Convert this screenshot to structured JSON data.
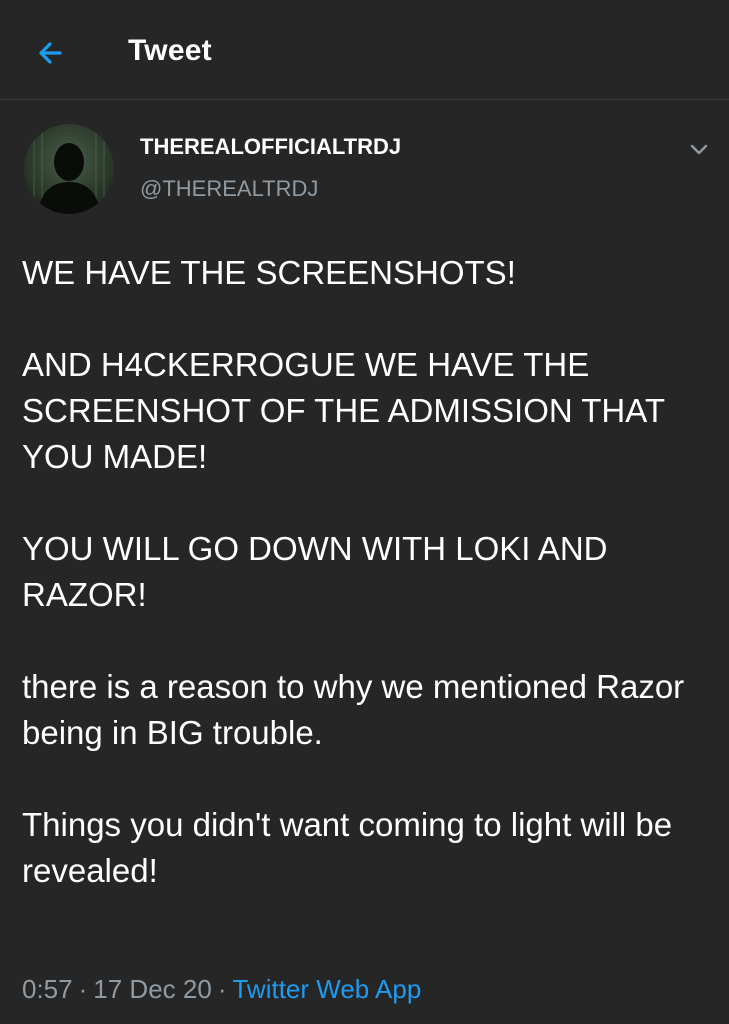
{
  "header": {
    "back_icon": "arrow-left-icon",
    "title": "Tweet"
  },
  "author": {
    "display_name": "THEREALOFFICIALTRDJ",
    "handle": "@THEREALTRDJ",
    "avatar_icon": "hooded-silhouette-avatar",
    "more_icon": "chevron-down-icon"
  },
  "tweet": {
    "paragraphs": [
      "WE HAVE THE SCREENSHOTS!",
      "AND H4CKERROGUE WE HAVE THE SCREENSHOT OF THE ADMISSION THAT YOU MADE!",
      "YOU WILL GO DOWN WITH LOKI AND RAZOR!",
      "there is a reason to why we mentioned Razor being in BIG trouble.",
      "Things you didn't want coming to light will be revealed!"
    ],
    "time": "0:57",
    "date": "17 Dec 20",
    "separator": "·",
    "source": "Twitter Web App"
  },
  "colors": {
    "background": "#262626",
    "accent": "#1d9bf0",
    "muted_text": "#8f9aa3",
    "primary_text": "#ffffff"
  }
}
